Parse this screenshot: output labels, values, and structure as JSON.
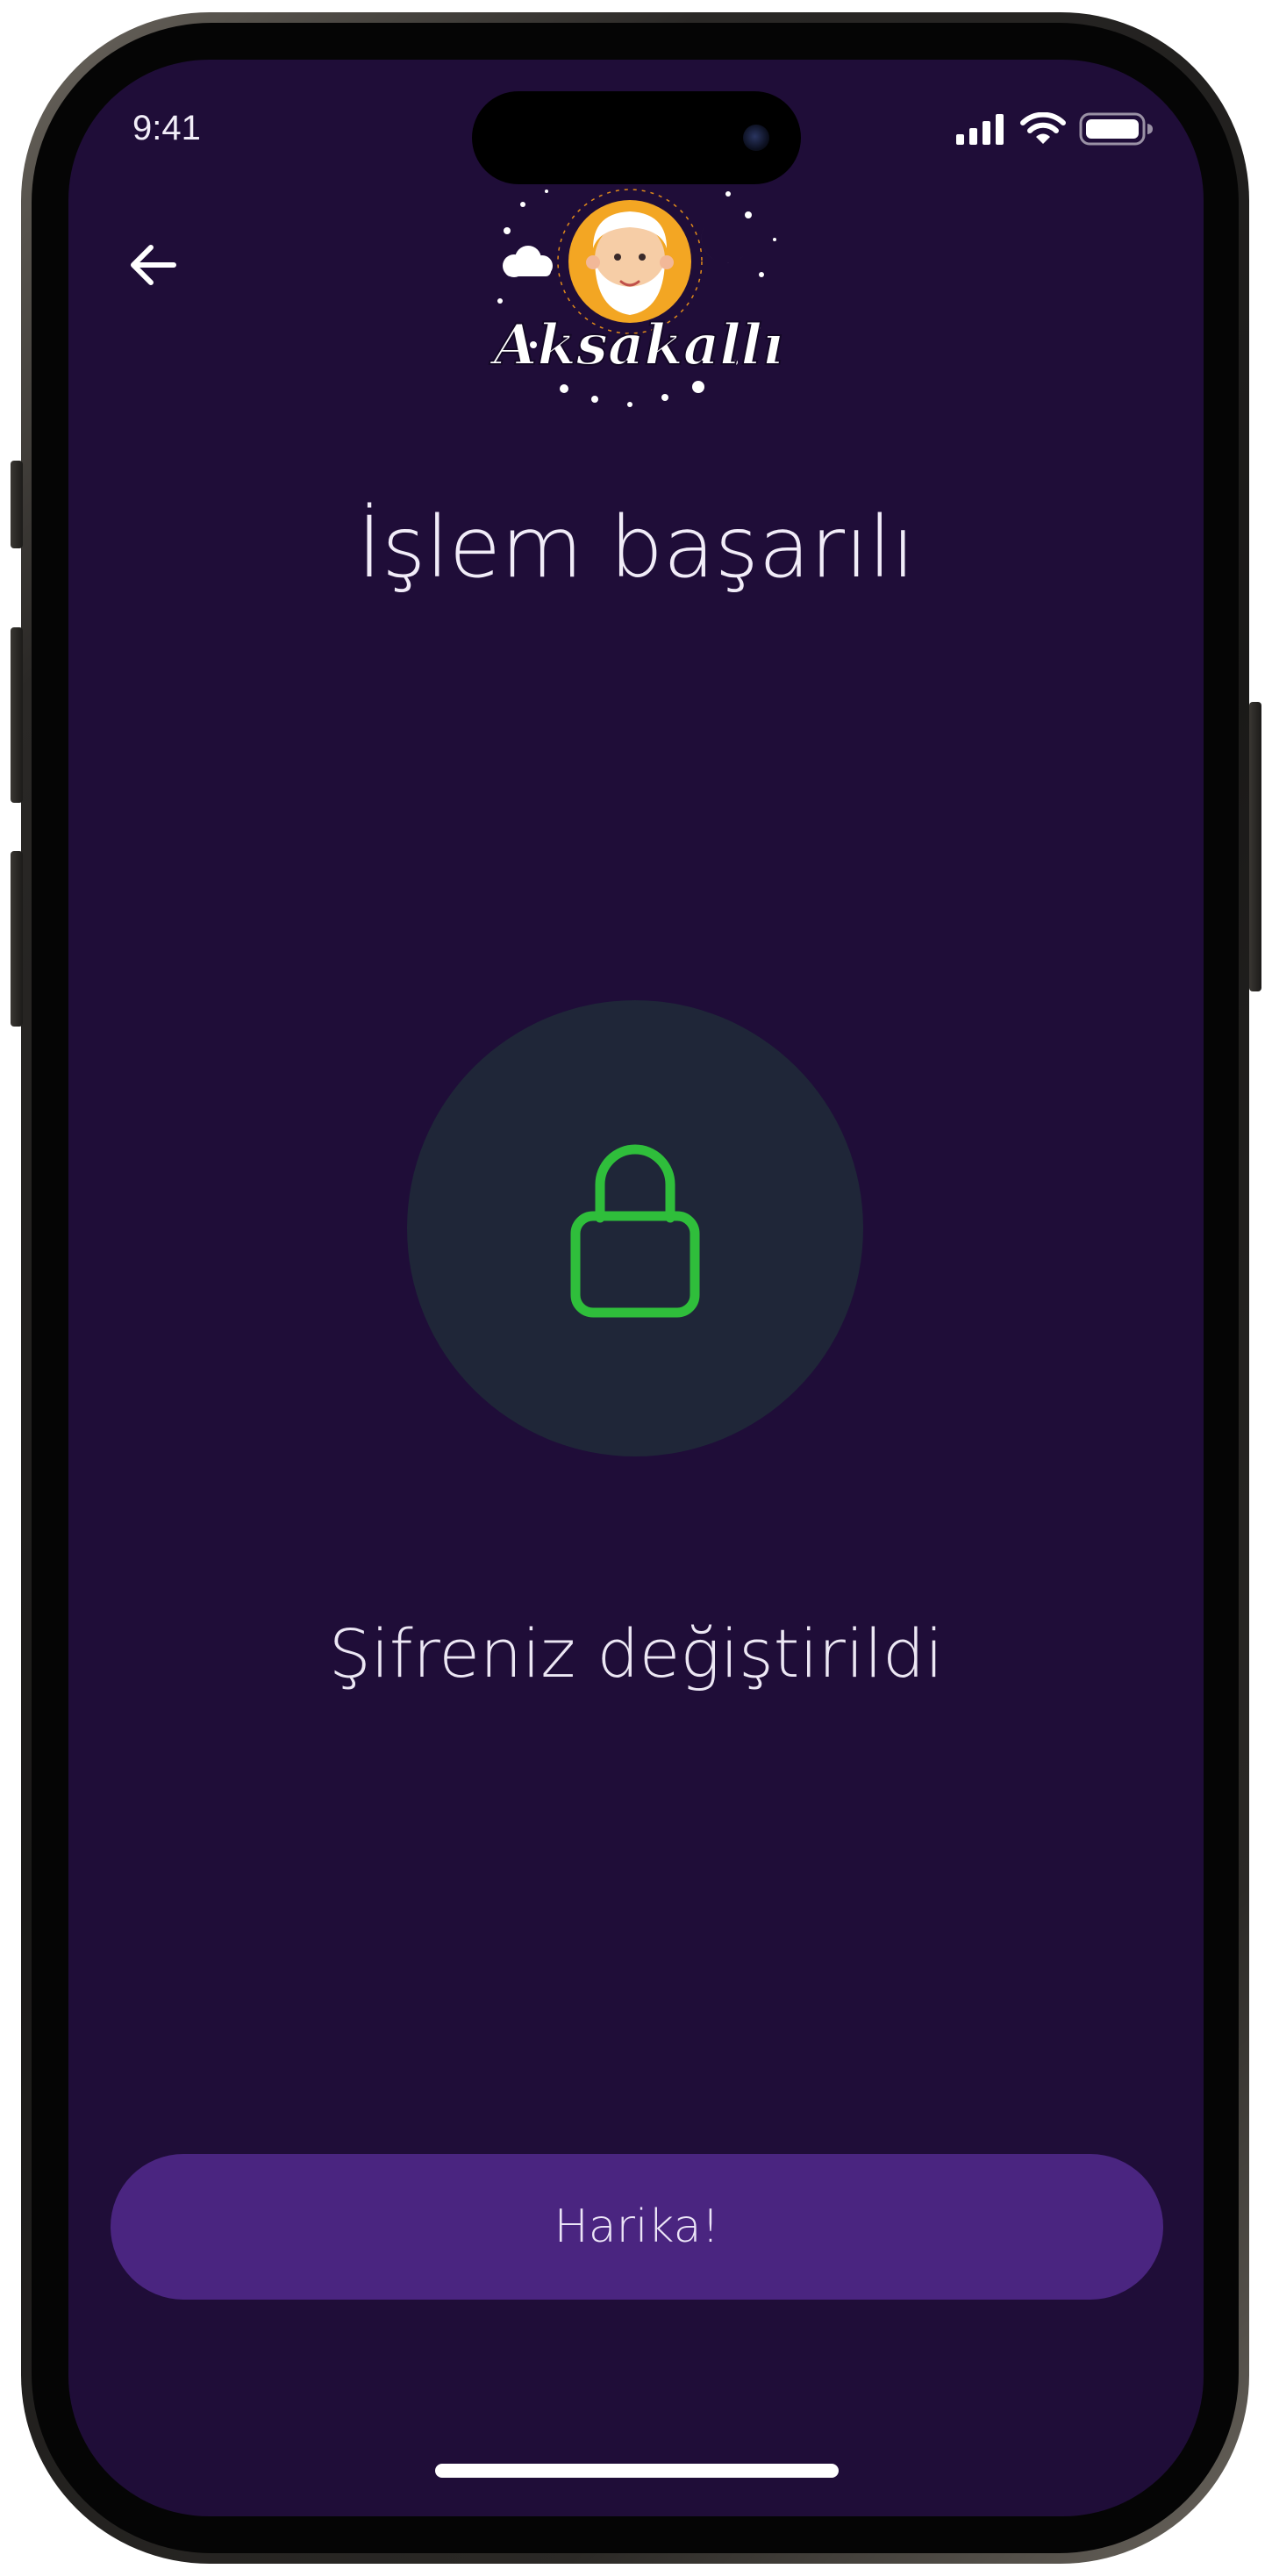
{
  "status_bar": {
    "time": "9:41"
  },
  "header": {
    "back_icon": "arrow-left-icon",
    "logo_text": "Aksakallı"
  },
  "title": "İşlem başarılı",
  "lock": {
    "icon": "lock-icon",
    "color": "#2fbe3b",
    "background": "#1f2638"
  },
  "message": "Şifreniz değiştirildi",
  "primary_button": {
    "label": "Harika!"
  },
  "colors": {
    "screen_background": "#1f0d38",
    "button_background": "#4a2580"
  }
}
